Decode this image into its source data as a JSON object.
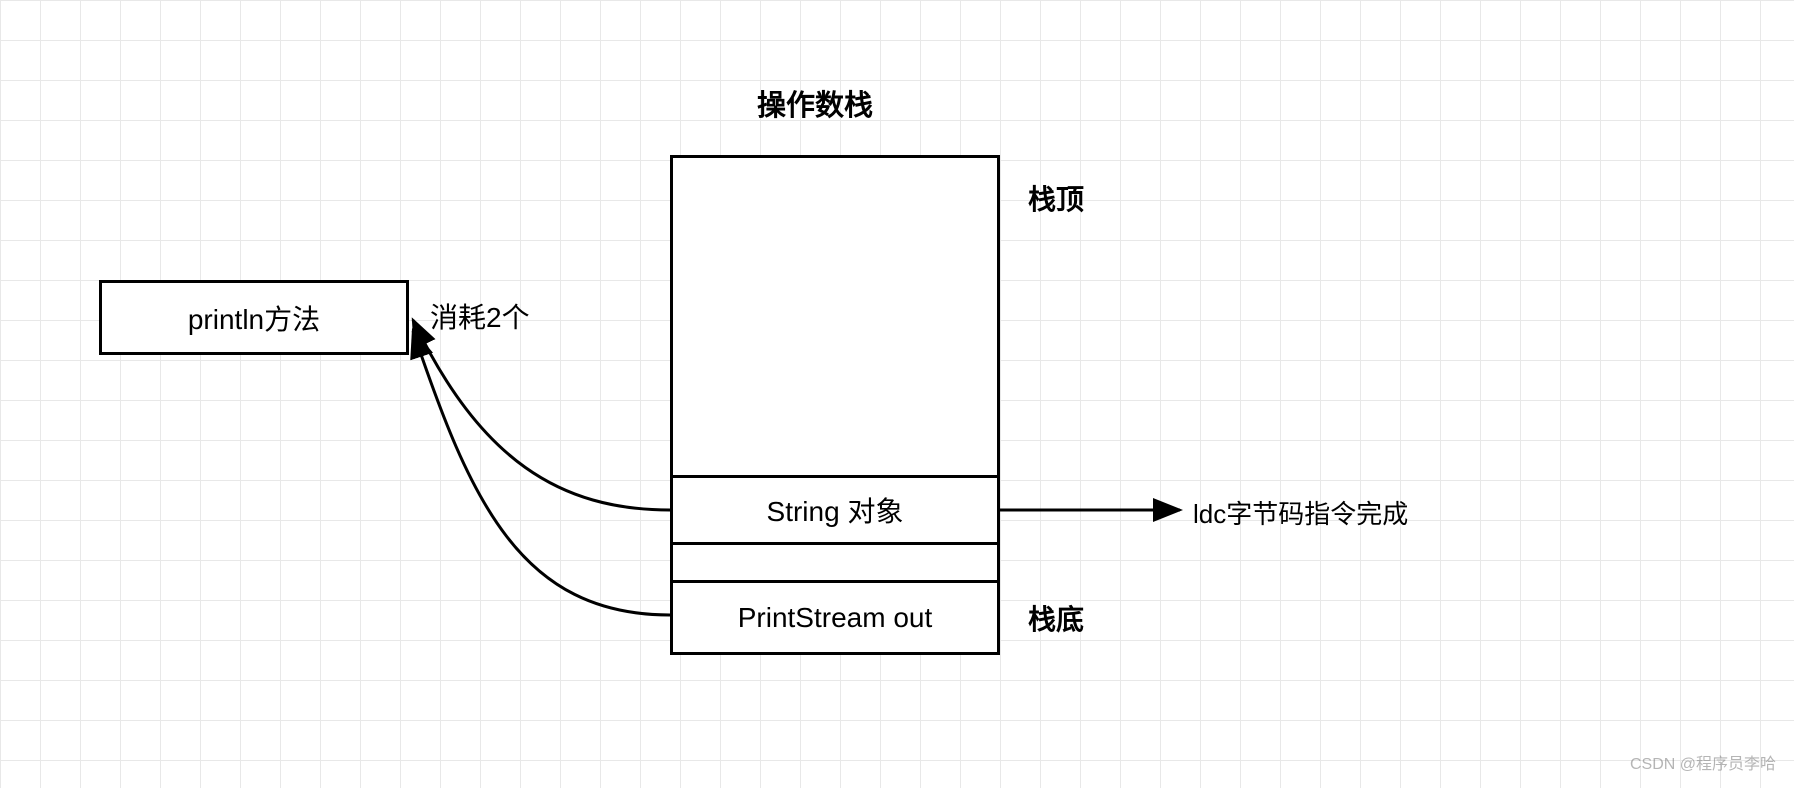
{
  "title": "操作数栈",
  "stack_top": "栈顶",
  "stack_bottom": "栈底",
  "method_box": "println方法",
  "consume_label": "消耗2个",
  "cells": {
    "string": "String 对象",
    "printstream": "PrintStream out"
  },
  "ldc_label": "ldc字节码指令完成",
  "watermark": "CSDN @程序员李哈"
}
